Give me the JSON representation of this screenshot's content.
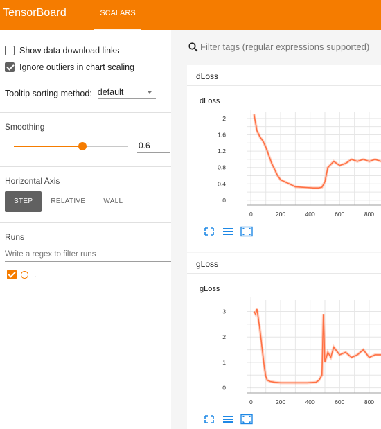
{
  "header": {
    "brand": "TensorBoard",
    "tab": "SCALARS"
  },
  "sidebar": {
    "show_download": {
      "label": "Show data download links",
      "checked": false
    },
    "ignore_outliers": {
      "label": "Ignore outliers in chart scaling",
      "checked": true
    },
    "tooltip": {
      "label": "Tooltip sorting method:",
      "value": "default"
    },
    "smoothing": {
      "title": "Smoothing",
      "value": "0.6",
      "fraction": 0.6
    },
    "horizontal_axis": {
      "title": "Horizontal Axis",
      "options": [
        "STEP",
        "RELATIVE",
        "WALL"
      ],
      "selected": "STEP"
    },
    "runs": {
      "title": "Runs",
      "placeholder": "Write a regex to filter runs",
      "items": [
        {
          "label": ".",
          "checked": true
        }
      ]
    }
  },
  "main": {
    "filter_placeholder": "Filter tags (regular expressions supported)",
    "sections": [
      {
        "category": "dLoss",
        "card_title": "dLoss"
      },
      {
        "category": "gLoss",
        "card_title": "gLoss"
      }
    ]
  },
  "colors": {
    "accent": "#f57c00",
    "series": "#ff7043"
  },
  "chart_data": [
    {
      "type": "line",
      "title": "dLoss",
      "xlabel": "",
      "ylabel": "",
      "x_ticks": [
        0,
        200,
        400,
        600,
        800
      ],
      "y_ticks": [
        0,
        0.4,
        0.8,
        1.2,
        1.6,
        2
      ],
      "xlim": [
        -30,
        880
      ],
      "ylim": [
        -0.12,
        2.15
      ],
      "series": [
        {
          "x": [
            20,
            40,
            60,
            80,
            100,
            120,
            140,
            160,
            180,
            200,
            230,
            260,
            300,
            340,
            380,
            420,
            460,
            480,
            500,
            520,
            560,
            600,
            640,
            680,
            720,
            760,
            800,
            840,
            880
          ],
          "y": [
            2.1,
            1.7,
            1.55,
            1.45,
            1.3,
            1.1,
            0.9,
            0.75,
            0.6,
            0.5,
            0.45,
            0.4,
            0.33,
            0.32,
            0.31,
            0.3,
            0.3,
            0.32,
            0.45,
            0.8,
            0.95,
            0.85,
            0.9,
            1.0,
            0.95,
            1.0,
            0.95,
            1.0,
            0.95
          ]
        }
      ]
    },
    {
      "type": "line",
      "title": "gLoss",
      "xlabel": "",
      "ylabel": "",
      "x_ticks": [
        0,
        200,
        400,
        600,
        800
      ],
      "y_ticks": [
        0,
        1,
        2,
        3
      ],
      "xlim": [
        -30,
        880
      ],
      "ylim": [
        -0.2,
        3.45
      ],
      "series": [
        {
          "x": [
            20,
            30,
            40,
            50,
            60,
            70,
            80,
            90,
            100,
            110,
            130,
            160,
            200,
            260,
            320,
            380,
            440,
            460,
            480,
            490,
            500,
            520,
            540,
            560,
            600,
            640,
            680,
            720,
            760,
            800,
            840,
            880
          ],
          "y": [
            3.0,
            2.9,
            3.1,
            2.7,
            2.3,
            1.8,
            1.3,
            0.8,
            0.45,
            0.3,
            0.25,
            0.22,
            0.2,
            0.2,
            0.2,
            0.2,
            0.22,
            0.3,
            0.5,
            2.9,
            1.0,
            1.4,
            1.2,
            1.6,
            1.3,
            1.4,
            1.2,
            1.3,
            1.5,
            1.2,
            1.3,
            1.3
          ]
        }
      ]
    }
  ]
}
